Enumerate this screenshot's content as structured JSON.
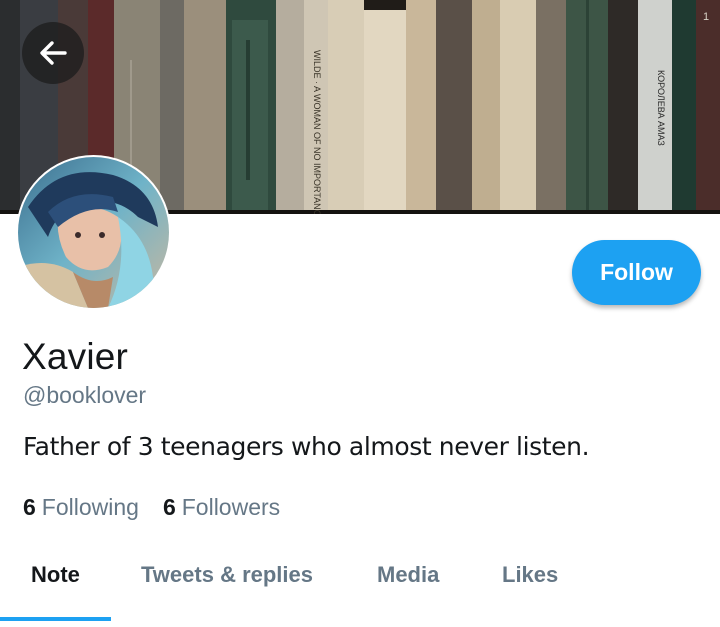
{
  "header": {
    "back_icon": "arrow-left-icon",
    "banner": "bookshelf-photo",
    "spine_texts": [
      "WILDE · A WOMAN OF NO IMPORTANCE",
      "КОРОЛЕВА АМАЗ",
      "1"
    ]
  },
  "profile": {
    "name": "Xavier",
    "handle": "@booklover",
    "bio": "Father of 3 teenagers who almost never listen.",
    "follow_label": "Follow",
    "following_count": "6",
    "following_label": "Following",
    "followers_count": "6",
    "followers_label": "Followers"
  },
  "tabs": [
    {
      "label": "Note",
      "active": true
    },
    {
      "label": "Tweets & replies",
      "active": false
    },
    {
      "label": "Media",
      "active": false
    },
    {
      "label": "Likes",
      "active": false
    }
  ],
  "colors": {
    "accent": "#1da1f2",
    "text": "#14171a",
    "secondary_text": "#657786"
  }
}
